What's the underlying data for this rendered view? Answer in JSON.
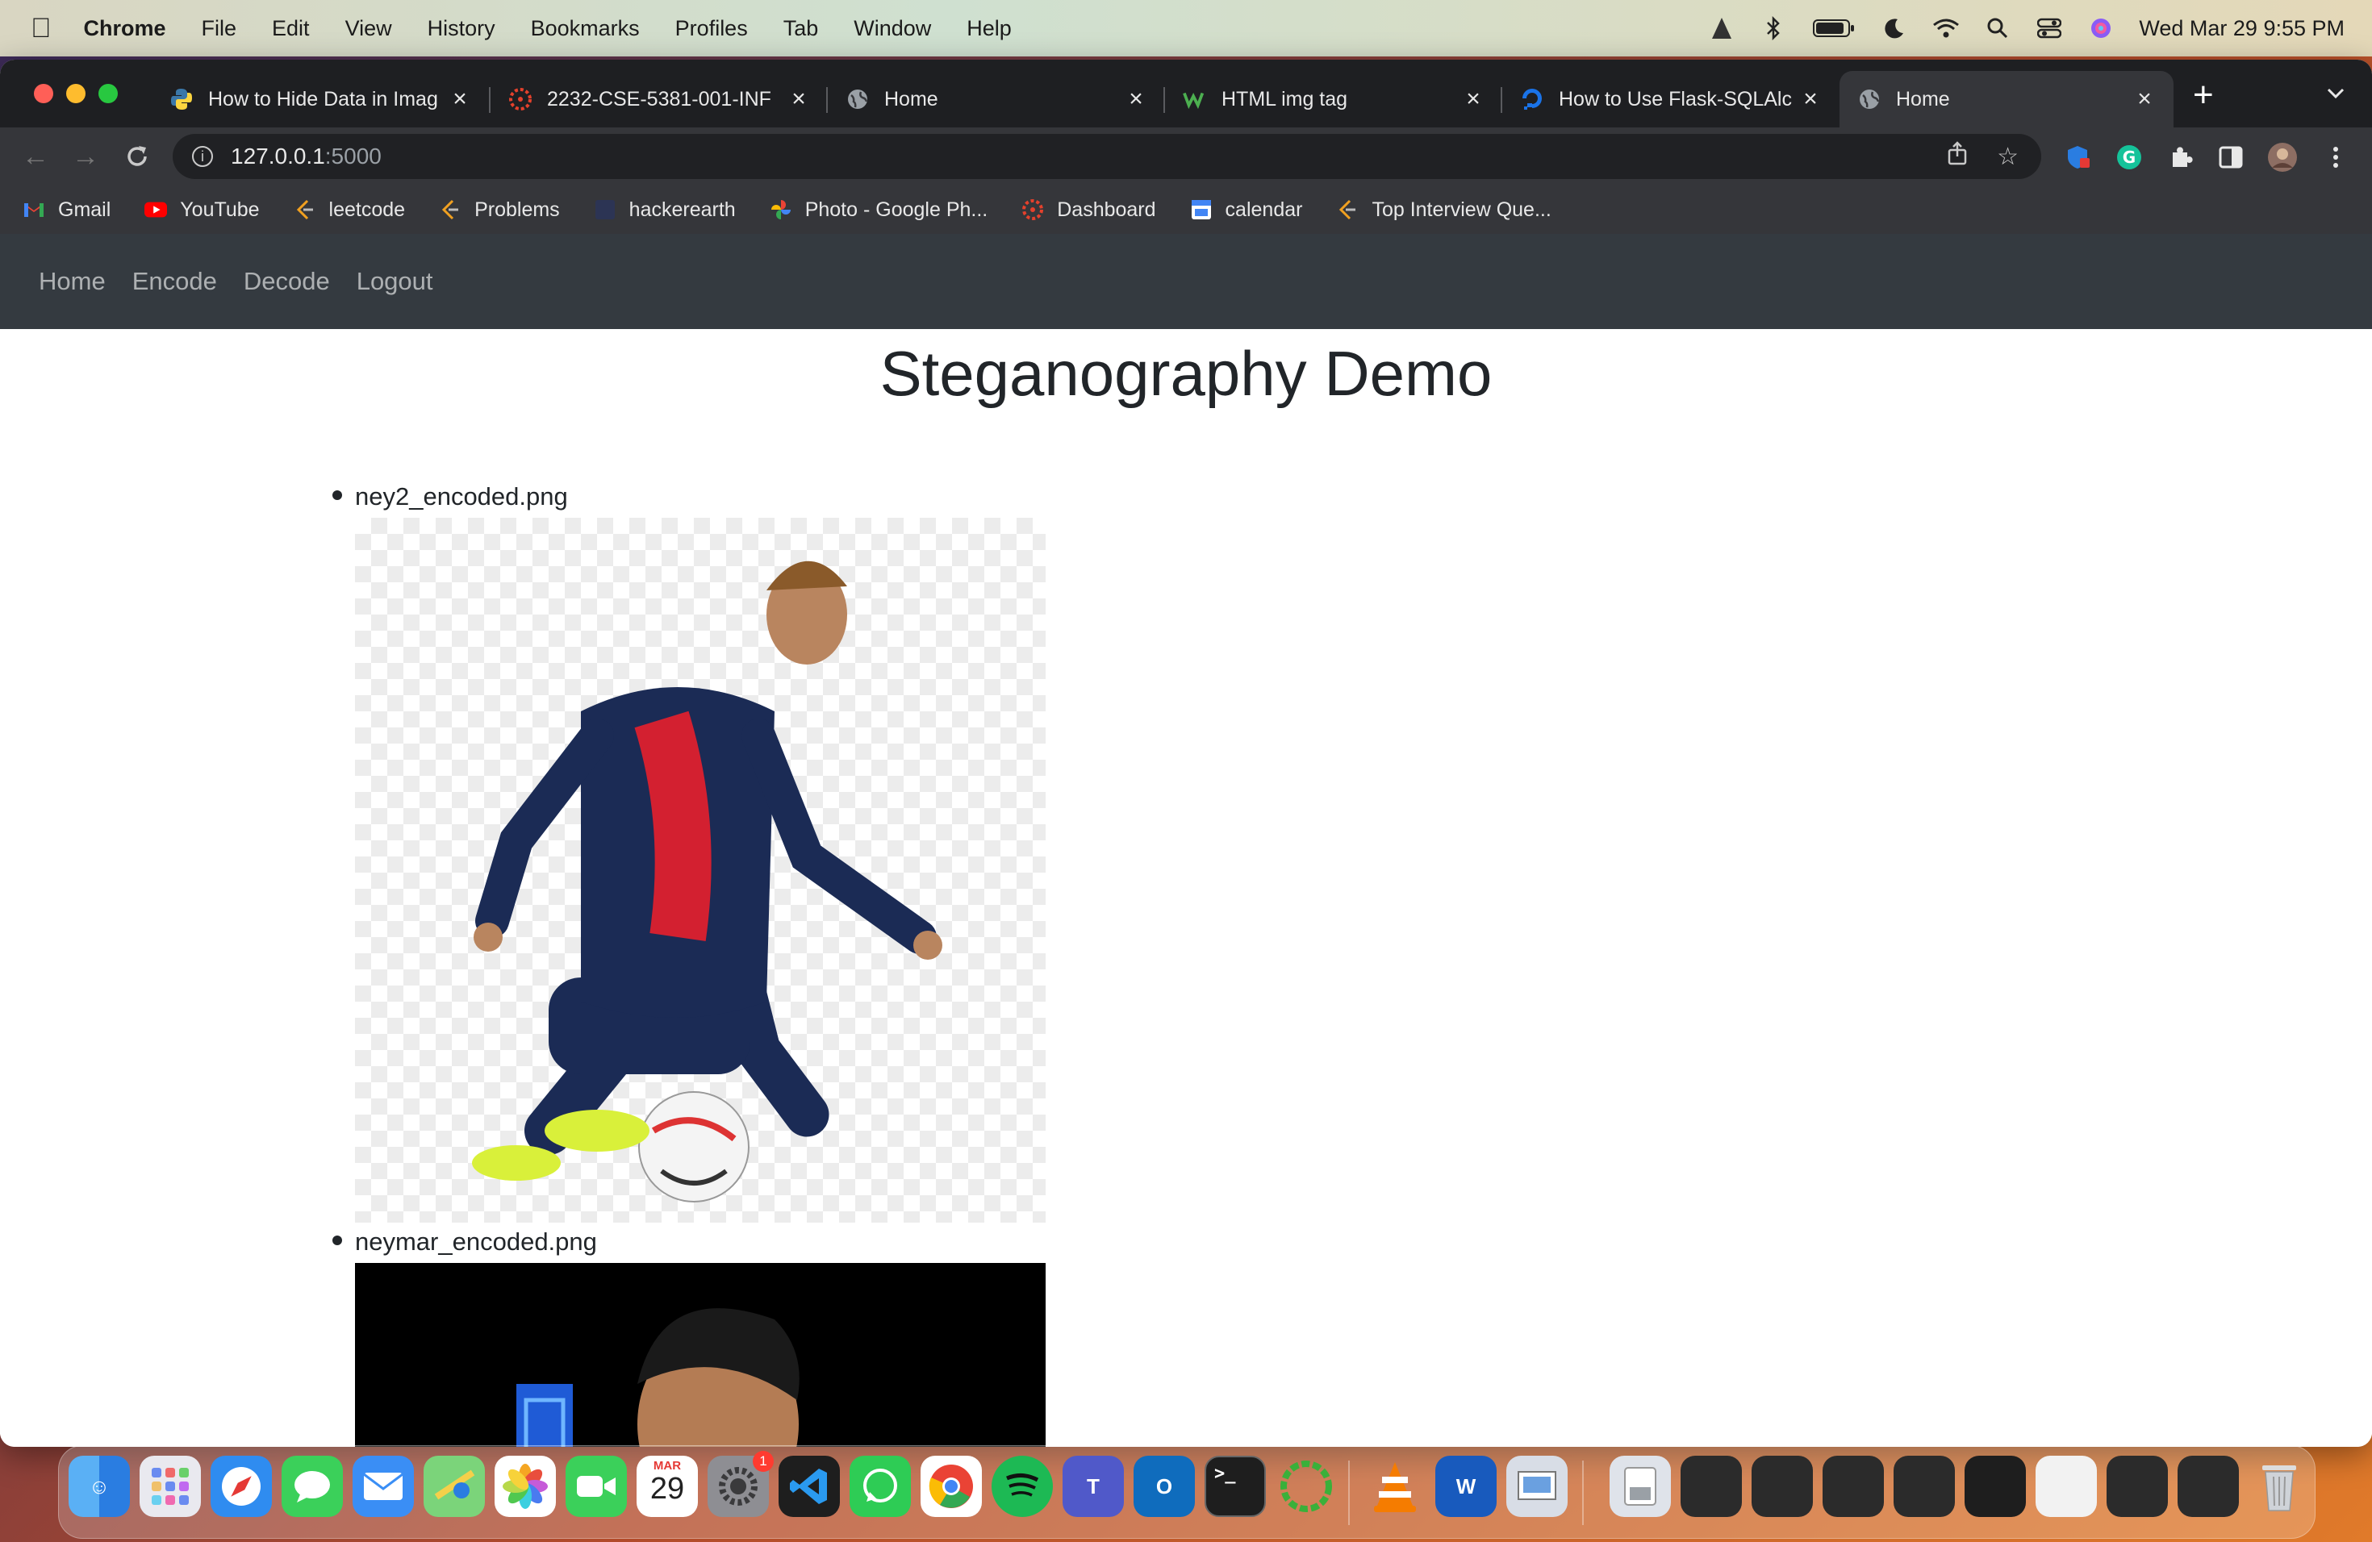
{
  "menubar": {
    "app_name": "Chrome",
    "menus": [
      "File",
      "Edit",
      "View",
      "History",
      "Bookmarks",
      "Profiles",
      "Tab",
      "Window",
      "Help"
    ],
    "datetime": "Wed Mar 29  9:55 PM"
  },
  "browser": {
    "tabs": [
      {
        "title": "How to Hide Data in Imag",
        "favicon": "python-icon"
      },
      {
        "title": "2232-CSE-5381-001-INF",
        "favicon": "canvas-icon"
      },
      {
        "title": "Home",
        "favicon": "globe-icon"
      },
      {
        "title": "HTML img tag",
        "favicon": "w3schools-icon"
      },
      {
        "title": "How to Use Flask-SQLAlc",
        "favicon": "digitalocean-icon"
      },
      {
        "title": "Home",
        "favicon": "globe-icon",
        "active": true
      }
    ],
    "url_host": "127.0.0.1",
    "url_port": ":5000",
    "bookmarks": [
      {
        "label": "Gmail",
        "icon": "gmail-icon"
      },
      {
        "label": "YouTube",
        "icon": "youtube-icon"
      },
      {
        "label": "leetcode",
        "icon": "leetcode-icon"
      },
      {
        "label": "Problems",
        "icon": "leetcode-icon"
      },
      {
        "label": "hackerearth",
        "icon": "hackerearth-icon"
      },
      {
        "label": "Photo - Google Ph...",
        "icon": "google-photos-icon"
      },
      {
        "label": "Dashboard",
        "icon": "canvas-icon"
      },
      {
        "label": "calendar",
        "icon": "calendar-icon"
      },
      {
        "label": "Top Interview Que...",
        "icon": "leetcode-icon"
      }
    ]
  },
  "site": {
    "nav": [
      "Home",
      "Encode",
      "Decode",
      "Logout"
    ],
    "title": "Steganography Demo",
    "files": [
      {
        "name": "ney2_encoded.png",
        "image": "soccer-player-transparent-image"
      },
      {
        "name": "neymar_encoded.png",
        "image": "soccer-player-portrait-image"
      }
    ]
  },
  "dock": {
    "calendar_month": "MAR",
    "calendar_day": "29",
    "settings_badge": "1"
  },
  "colors": {
    "site_nav_bg": "#343a40",
    "tab_bar_bg": "#1e1f22",
    "toolbar_bg": "#35363a"
  }
}
